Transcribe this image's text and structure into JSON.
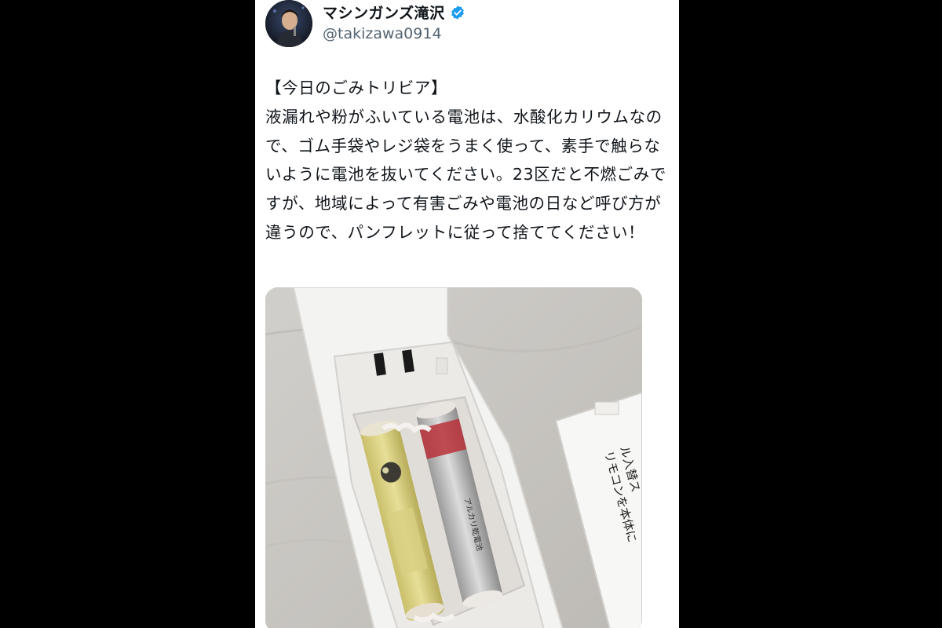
{
  "tweet": {
    "display_name": "マシンガンズ滝沢",
    "handle": "@takizawa0914",
    "text": "【今日のごみトリビア】\n液漏れや粉がふいている電池は、水酸化カリウムなので、ゴム手袋やレジ袋をうまく使って、素手で触らないように電池を抜いてください。23区だと不燃ごみですが、地域によって有害ごみや電池の日など呼び方が違うので、パンフレットに従って捨ててください！"
  },
  "photo": {
    "battery_label": "アルカリ乾電池",
    "cover_text_1": "リモコンを本体に",
    "cover_text_2": "ル入替ス"
  },
  "colors": {
    "background": "#000000",
    "card": "#ffffff",
    "verified": "#1d9bf0",
    "handle_gray": "#536471"
  },
  "icons": [
    "verified-badge-icon",
    "avatar"
  ]
}
